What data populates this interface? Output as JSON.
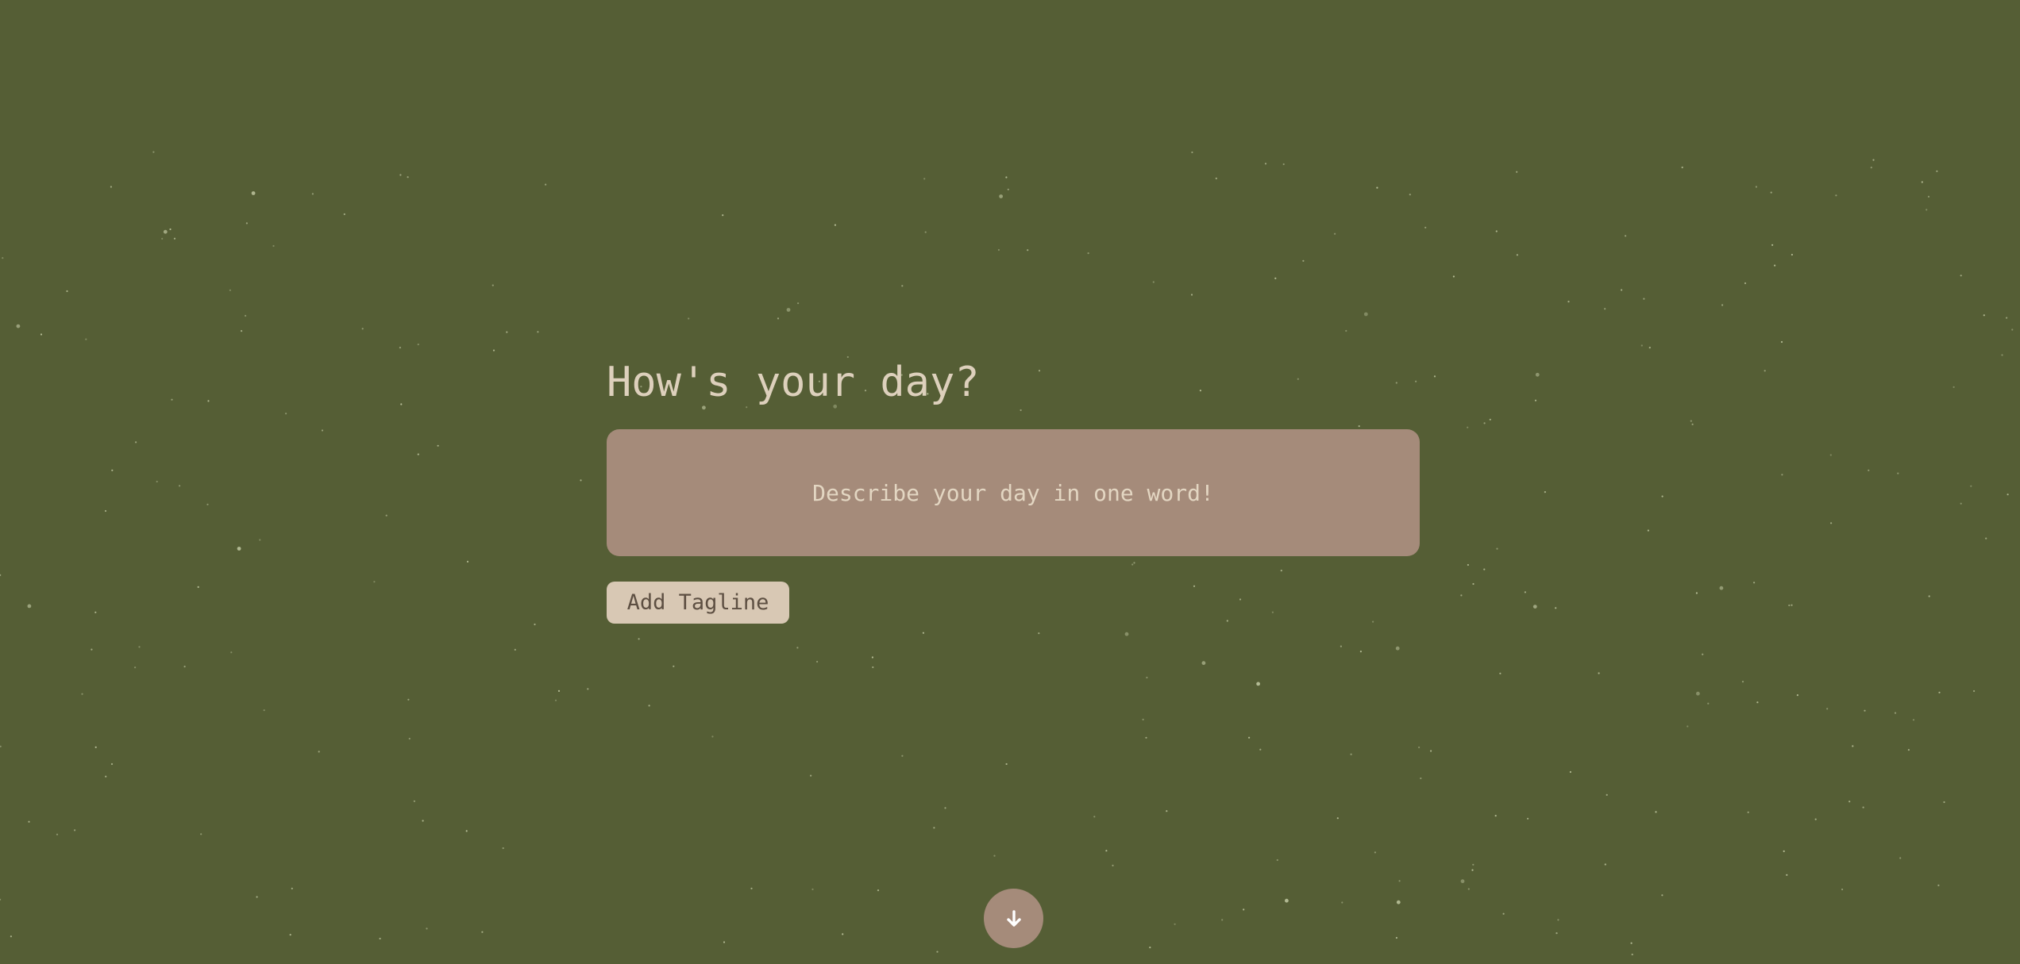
{
  "page": {
    "title": "How's your day?"
  },
  "tagline_input": {
    "value": "",
    "placeholder": "Describe your day in one word!"
  },
  "add_button": {
    "label": "Add Tagline"
  },
  "scroll_button": {
    "icon": "arrow-down-icon"
  },
  "colors": {
    "background": "#555e35",
    "title": "#ddd0bc",
    "input_background": "#a58b7a",
    "button_background": "#d8c8b4",
    "button_text": "#5d4f42",
    "star": "#cfd6b0"
  }
}
